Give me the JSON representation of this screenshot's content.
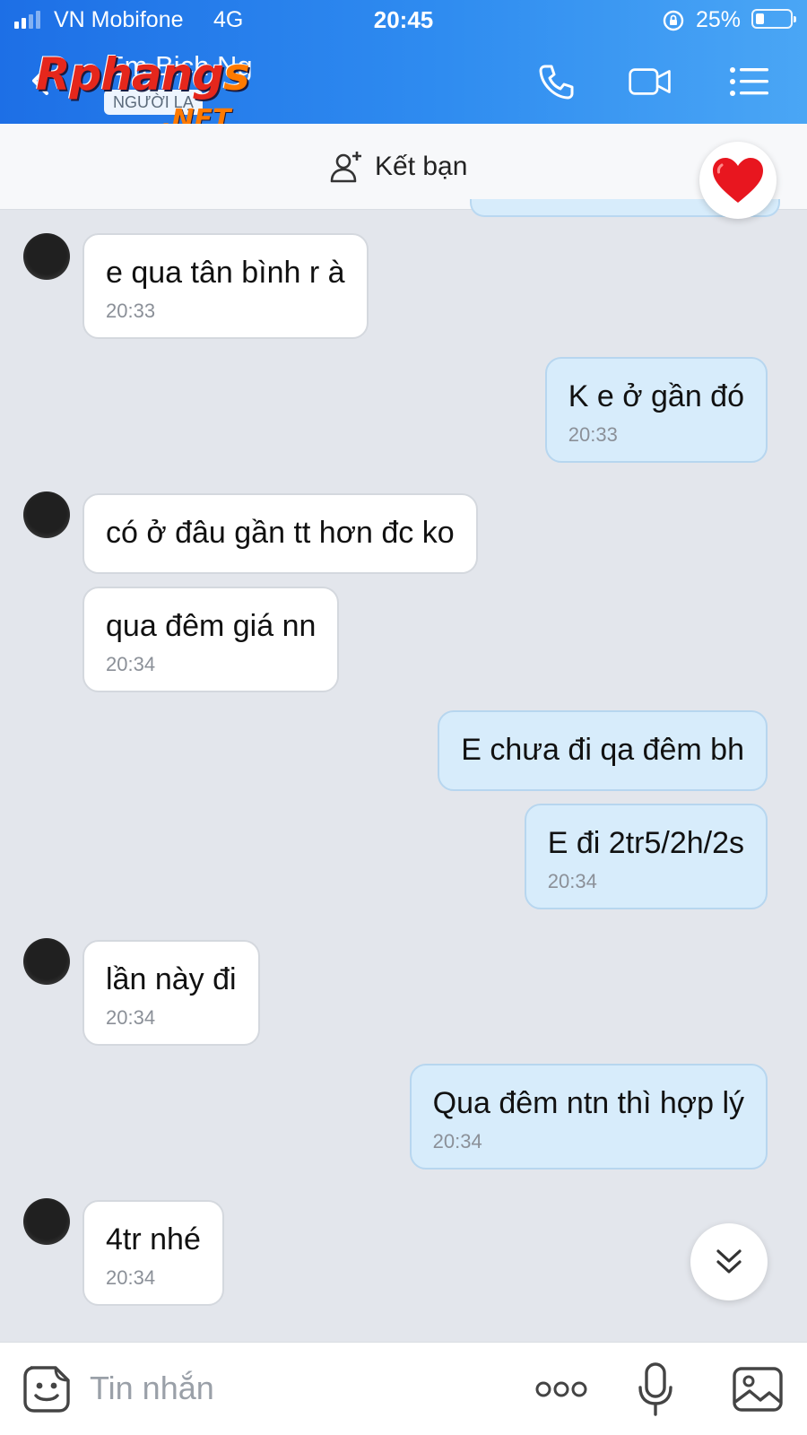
{
  "status_bar": {
    "carrier": "VN Mobifone",
    "network": "4G",
    "time": "20:45",
    "battery": "25%",
    "battery_level": 0.25
  },
  "header": {
    "contact_name": "Em Bich Ng",
    "stranger_tag": "NGƯỜI LẠ",
    "icons": [
      "back-icon",
      "phone-icon",
      "video-camera-icon",
      "menu-list-icon"
    ]
  },
  "watermark": {
    "logo": "Rphangs",
    "suffix": ".NET"
  },
  "add_friend": {
    "label": "Kết bạn"
  },
  "messages": [
    {
      "side": "in",
      "text": "e qua tân bình r à",
      "time": "20:33"
    },
    {
      "side": "out",
      "text": "K e ở gần đó",
      "time": "20:33"
    },
    {
      "side": "in",
      "text": "có ở đâu gần tt hơn đc ko",
      "time": ""
    },
    {
      "side": "in",
      "text": "qua đêm giá nn",
      "time": "20:34"
    },
    {
      "side": "out",
      "text": "E chưa đi qa đêm bh",
      "time": ""
    },
    {
      "side": "out",
      "text": "E đi 2tr5/2h/2s",
      "time": "20:34"
    },
    {
      "side": "in",
      "text": "lần này đi",
      "time": "20:34"
    },
    {
      "side": "out",
      "text": "Qua đêm ntn thì hợp lý",
      "time": "20:34"
    },
    {
      "side": "in",
      "text": "4tr nhé",
      "time": "20:34"
    }
  ],
  "input": {
    "placeholder": "Tin nhắn"
  },
  "colors": {
    "header_gradient_start": "#1d6fe6",
    "header_gradient_end": "#4aa6f5",
    "outgoing_bubble": "#d7ecfb",
    "incoming_bubble": "#ffffff",
    "chat_background": "#e3e6ec"
  }
}
